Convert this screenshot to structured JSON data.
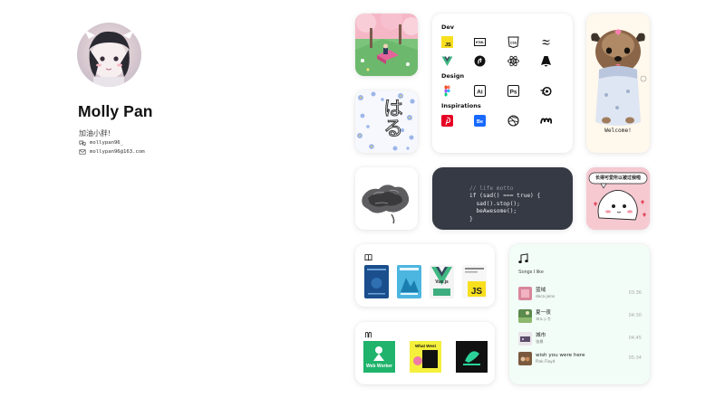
{
  "profile": {
    "name": "Molly Pan",
    "bio": "加油小胖!",
    "wechat": "mollypan96_",
    "email": "mollypan96@163.com"
  },
  "tools": {
    "sections": [
      {
        "title": "Dev",
        "icons": [
          "javascript-icon",
          "html-icon",
          "css-icon",
          "tailwind-icon",
          "vue-icon",
          "dev-tool-icon",
          "atom-icon",
          "astro-icon"
        ]
      },
      {
        "title": "Design",
        "icons": [
          "figma-icon",
          "illustrator-icon",
          "photoshop-icon",
          "blender-icon"
        ]
      },
      {
        "title": "Inspirations",
        "icons": [
          "pinterest-icon",
          "behance-icon",
          "dribbble-icon",
          "mobbin-icon"
        ]
      }
    ],
    "labels": {
      "html": "HTML",
      "css": "CSS",
      "ai": "Ai",
      "ps": "Ps",
      "be": "Be"
    }
  },
  "dog": {
    "caption": "Welcome!"
  },
  "motto": {
    "comment": "// life motto",
    "line1": "if (sad() === true) {",
    "line2": "  sad().stop();",
    "line3": "  beAwesome();",
    "line4": "}"
  },
  "sticker": {
    "text": "长得可爱所以被过我啦"
  },
  "haru": {
    "text": "はる"
  },
  "books": {
    "icon": "book-icon",
    "covers": [
      "book-cover-1",
      "book-cover-2",
      "vuejs-book-cover",
      "javascript-book-cover"
    ],
    "vue_label": "Vue.js",
    "js_label": "JS"
  },
  "podcasts": {
    "icon": "podcast-icon",
    "covers": [
      {
        "name": "web-worker-podcast-cover",
        "title": "Web Worker",
        "color": "#1fb36b"
      },
      {
        "name": "what-west-podcast-cover",
        "title": "What West",
        "color": "#f4f03c"
      },
      {
        "name": "third-podcast-cover",
        "title": "",
        "color": "#111111"
      }
    ]
  },
  "songs": {
    "title": "Songs I like",
    "items": [
      {
        "title": "蓝绒",
        "artist": "deca joins",
        "duration": "03:36"
      },
      {
        "title": "夏一夜",
        "artist": "ヨルシカ",
        "duration": "04:30"
      },
      {
        "title": "城市",
        "artist": "张悬",
        "duration": "04:45"
      },
      {
        "title": "wish you were here",
        "artist": "Pink Floyd",
        "duration": "05:34"
      }
    ]
  },
  "colors": {
    "motto_bg": "#363a44",
    "songs_bg": "#f2fdf7",
    "sticker_bg": "#f6c9d1"
  }
}
